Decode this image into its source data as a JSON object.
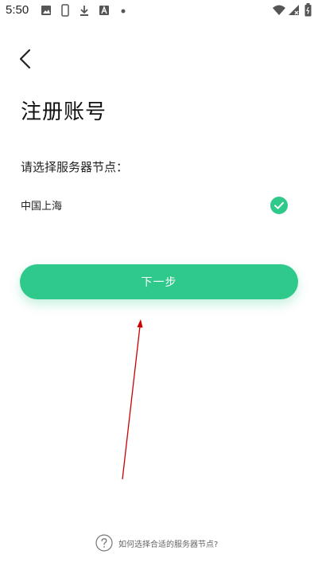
{
  "status_bar": {
    "time": "5:50",
    "icons": [
      "image-icon",
      "phone-outline-icon",
      "download-icon",
      "text-a-icon",
      "dot-icon",
      "wifi-icon",
      "signal-icon",
      "battery-icon"
    ]
  },
  "header": {
    "back_icon": "chevron-left-icon",
    "title": "注册账号"
  },
  "server_select": {
    "label": "请选择服务器节点：",
    "options": [
      {
        "name": "中国上海",
        "selected": true
      }
    ]
  },
  "actions": {
    "next_label": "下一步"
  },
  "help": {
    "icon": "question-circle-icon",
    "text": "如何选择合适的服务器节点?"
  },
  "colors": {
    "accent": "#2ec98b",
    "annotation": "#cc0000"
  }
}
